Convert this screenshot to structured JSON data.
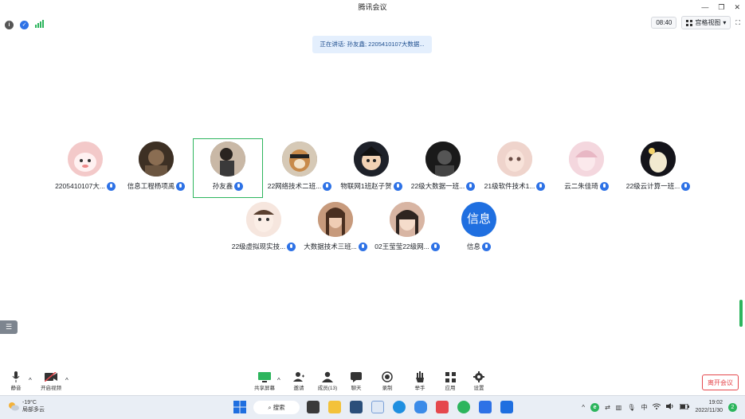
{
  "window": {
    "title": "腾讯会议",
    "min_glyph": "—",
    "restore_glyph": "❐",
    "close_glyph": "✕"
  },
  "toolbar": {
    "elapsed": "08:40",
    "view_mode": "宫格视图",
    "view_caret": "▾",
    "fullscreen_glyph": "⛶"
  },
  "speaking": {
    "text": "正在讲话: 孙友鑫; 2205410107大数据..."
  },
  "participants": [
    {
      "name": "2205410107大...",
      "avatar_color": "#f3c9c9"
    },
    {
      "name": "信息工程杨项禹",
      "avatar_color": "#5a4a3a"
    },
    {
      "name": "孙友鑫",
      "avatar_color": "#6b5a48",
      "speaking": true
    },
    {
      "name": "22网络技术二班...",
      "avatar_color": "#8a7a66"
    },
    {
      "name": "物联网1班赵子贺",
      "avatar_color": "#3a3f4a"
    },
    {
      "name": "22级大数据一班...",
      "avatar_color": "#2b2b2b"
    },
    {
      "name": "21级软件技术1...",
      "avatar_color": "#e9c7be"
    },
    {
      "name": "云二朱佳琦",
      "avatar_color": "#f0cfd6"
    },
    {
      "name": "22级云计算一班...",
      "avatar_color": "#1f1f24"
    },
    {
      "name": "22级虚拟现实技...",
      "avatar_color": "#f2ddd3"
    },
    {
      "name": "大数据技术三班...",
      "avatar_color": "#b98a6e"
    },
    {
      "name": "02王莹莹22级网...",
      "avatar_color": "#c9a18f"
    },
    {
      "name": "信息",
      "avatar_text": "信息",
      "avatar_color": "#1f6fe0"
    }
  ],
  "controls": {
    "mute": "静音",
    "video": "开启视频",
    "share": "共享屏幕",
    "invite": "邀请",
    "members": "成员(13)",
    "chat": "聊天",
    "record": "录制",
    "raise_hand": "举手",
    "apps": "应用",
    "settings": "设置",
    "leave": "离开会议",
    "caret": "^"
  },
  "side_handle_glyph": "☰",
  "taskbar": {
    "temperature": "-19°C",
    "weather": "局部多云",
    "search": "搜索",
    "ime": "中",
    "time": "19:02",
    "date": "2022/11/30",
    "notifications": "2",
    "tray_caret": "^"
  },
  "colors": {
    "accent_blue": "#2e72e6",
    "speaking_green": "#2db55d",
    "leave_red": "#e5484d"
  }
}
